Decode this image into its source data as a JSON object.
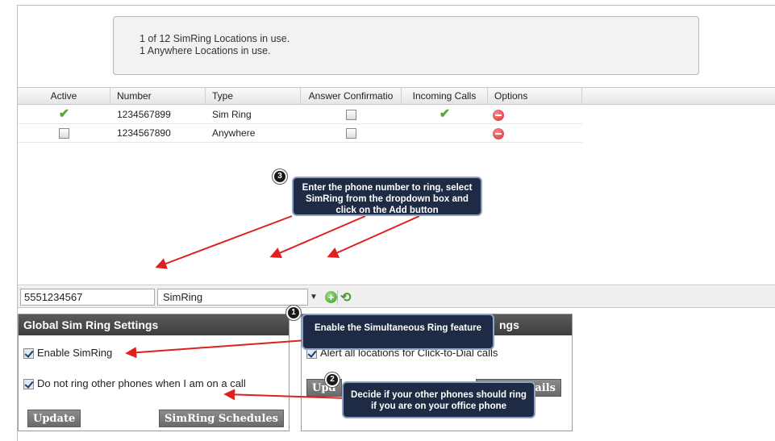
{
  "summary": {
    "line1": "1 of 12 SimRing Locations in use.",
    "line2": "1 Anywhere Locations in use."
  },
  "table": {
    "columns": [
      "Active",
      "Number",
      "Type",
      "Answer Confirmatio",
      "Incoming Calls",
      "Options"
    ],
    "rows": [
      {
        "active": "checked",
        "number": "1234567899",
        "type": "Sim Ring",
        "answer_confirmation": "unchecked",
        "incoming_calls": "checked",
        "options": "remove-icon"
      },
      {
        "active": "unchecked",
        "number": "1234567890",
        "type": "Anywhere",
        "answer_confirmation": "unchecked",
        "incoming_calls": "",
        "options": "remove-icon"
      }
    ]
  },
  "add_bar": {
    "phone_value": "5551234567",
    "type_selected": "SimRing"
  },
  "global_settings": {
    "title": "Global Sim Ring Settings",
    "enable_label": "Enable SimRing",
    "do_not_ring_label": "Do not ring other phones when I am on a call",
    "update_label": "Update",
    "schedules_label": "SimRing Schedules"
  },
  "right_panel": {
    "title_fragment": "ngs",
    "alert_label": "Alert all locations for Click-to-Dial calls",
    "update_fragment": "Upd",
    "details_fragment": "tails"
  },
  "callouts": {
    "c1": {
      "badge": "1",
      "text": "Enable the Simultaneous Ring feature"
    },
    "c2": {
      "badge": "2",
      "text": "Decide if your other phones should ring if you are on your office phone"
    },
    "c3": {
      "badge": "3",
      "text": "Enter the phone number to ring, select SimRing from the dropdown box and click on the Add button"
    }
  },
  "colors": {
    "callout_bg": "#1f2a44",
    "arrow": "#e02020",
    "panel_header": "#4a4a4a"
  }
}
